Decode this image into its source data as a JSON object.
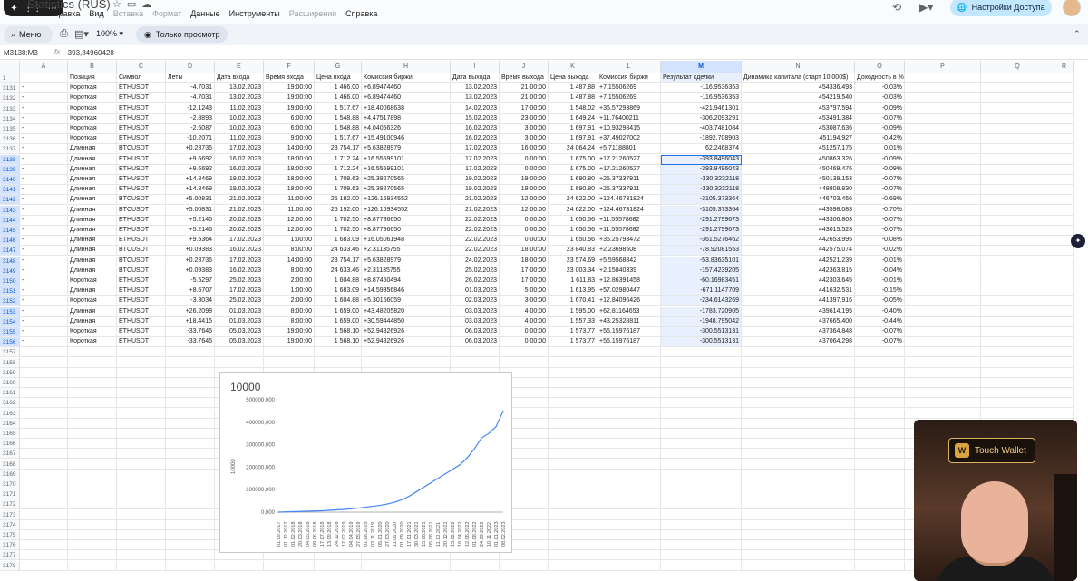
{
  "app": {
    "doc_title": "Statistics (RUS)",
    "menu": [
      "Правка",
      "Вид",
      "Вставка",
      "Формат",
      "Данные",
      "Инструменты",
      "Расширения",
      "Справка"
    ],
    "menu_dim": [
      false,
      false,
      true,
      true,
      false,
      false,
      true,
      false
    ],
    "share_label": "Настройки Доступа"
  },
  "toolbar": {
    "menu_label": "Меню",
    "zoom": "100%",
    "view_only": "Только просмотр"
  },
  "formula": {
    "namebox": "M3138:M3",
    "value": "-393,84960428"
  },
  "columns": [
    "A",
    "B",
    "C",
    "D",
    "E",
    "F",
    "G",
    "H",
    "I",
    "J",
    "K",
    "L",
    "M",
    "N",
    "O",
    "P",
    "Q",
    "R"
  ],
  "header_row": {
    "num": "1",
    "cells": [
      "",
      "Позиция",
      "Символ",
      "Леты",
      "Дата входа",
      "Время входа",
      "Цена входа",
      "Комиссия биржи",
      "Дата выхода",
      "Время выхода",
      "Цена выхода",
      "Комиссия биржи",
      "Результат сделки",
      "Динамика капитала (старт 10 000$)",
      "Доходность в %",
      "",
      "",
      ""
    ]
  },
  "rows": [
    {
      "n": "3131",
      "c": [
        "-",
        "Короткая",
        "ETHUSDT",
        "-4.7031",
        "13.02.2023",
        "19:00:00",
        "1 466.00",
        "+6.89474460",
        "13.02.2023",
        "21:00:00",
        "1 487.88",
        "+7.15506269",
        "-116.9536353",
        "454336.493",
        "-0.03%"
      ]
    },
    {
      "n": "3132",
      "c": [
        "-",
        "Короткая",
        "ETHUSDT",
        "-4.7031",
        "13.02.2023",
        "19:00:00",
        "1 466.00",
        "+6.89474460",
        "13.02.2023",
        "21:00:00",
        "1 487.88",
        "+7.15506269",
        "-116.9536353",
        "454219.540",
        "-0.03%"
      ]
    },
    {
      "n": "3133",
      "c": [
        "-",
        "Короткая",
        "ETHUSDT",
        "-12.1243",
        "11.02.2023",
        "19:00:00",
        "1 517.67",
        "+18.40068638",
        "14.02.2023",
        "17:00:00",
        "1 548.02",
        "+35.57293869",
        "-421.9461301",
        "453797.594",
        "-0.09%"
      ]
    },
    {
      "n": "3134",
      "c": [
        "-",
        "Короткая",
        "ETHUSDT",
        "-2.8893",
        "10.02.2023",
        "6:00:00",
        "1 548.88",
        "+4.47517898",
        "15.02.2023",
        "23:00:00",
        "1 649.24",
        "+11.76400211",
        "-306.2093291",
        "453491.384",
        "-0.07%"
      ]
    },
    {
      "n": "3135",
      "c": [
        "-",
        "Короткая",
        "ETHUSDT",
        "-2.6087",
        "10.02.2023",
        "6:00:00",
        "1 548.88",
        "+4.04056326",
        "16.02.2023",
        "3:00:00",
        "1 697.91",
        "+10.93298415",
        "-403.7481084",
        "453087.636",
        "-0.09%"
      ]
    },
    {
      "n": "3136",
      "c": [
        "-",
        "Короткая",
        "ETHUSDT",
        "-10.2071",
        "11.02.2023",
        "9:00:00",
        "1 517.67",
        "+15.49100946",
        "16.02.2023",
        "3:00:00",
        "1 697.91",
        "+37.49027002",
        "-1892.708903",
        "451194.927",
        "-0.42%"
      ]
    },
    {
      "n": "3137",
      "c": [
        "-",
        "Длинная",
        "BTCUSDT",
        "+0.23736",
        "17.02.2023",
        "14:00:00",
        "23 754.17",
        "+5.63828979",
        "17.02.2023",
        "16:00:00",
        "24 064.24",
        "+5.71188801",
        "62.2468374",
        "451257.175",
        "0.01%"
      ]
    },
    {
      "n": "3138",
      "c": [
        "-",
        "Длинная",
        "ETHUSDT",
        "+9.6692",
        "16.02.2023",
        "18:00:00",
        "1 712.24",
        "+16.55599101",
        "17.02.2023",
        "0:00:00",
        "1 675.00",
        "+17.21260527",
        "-393.8496043",
        "450863.326",
        "-0.09%"
      ]
    },
    {
      "n": "3139",
      "c": [
        "-",
        "Длинная",
        "ETHUSDT",
        "+9.6692",
        "16.02.2023",
        "18:00:00",
        "1 712.24",
        "+16.55599101",
        "17.02.2023",
        "0:00:00",
        "1 675.00",
        "+17.21260527",
        "-393.8496043",
        "450469.476",
        "-0.09%"
      ]
    },
    {
      "n": "3140",
      "c": [
        "-",
        "Длинная",
        "ETHUSDT",
        "+14.8469",
        "19.02.2023",
        "18:00:00",
        "1 709.63",
        "+25.38270565",
        "19.02.2023",
        "19:00:00",
        "1 690.80",
        "+25.37337911",
        "-330.3232118",
        "450139.153",
        "-0.07%"
      ]
    },
    {
      "n": "3141",
      "c": [
        "-",
        "Длинная",
        "ETHUSDT",
        "+14.8469",
        "19.02.2023",
        "18:00:00",
        "1 709.63",
        "+25.38270565",
        "19.02.2023",
        "19:00:00",
        "1 690.80",
        "+25.37337911",
        "-330.3232118",
        "449808.830",
        "-0.07%"
      ]
    },
    {
      "n": "3142",
      "c": [
        "-",
        "Длинная",
        "BTCUSDT",
        "+5.00831",
        "21.02.2023",
        "11:00:00",
        "25 192.00",
        "+126.16934552",
        "21.02.2023",
        "12:00:00",
        "24 622.00",
        "+124.46731824",
        "-3105.373364",
        "446703.456",
        "-0.69%"
      ]
    },
    {
      "n": "3143",
      "c": [
        "-",
        "Длинная",
        "BTCUSDT",
        "+5.00831",
        "21.02.2023",
        "11:00:00",
        "25 192.00",
        "+126.16934552",
        "21.02.2023",
        "12:00:00",
        "24 622.00",
        "+124.46731824",
        "-3105.373364",
        "443598.083",
        "-0.70%"
      ]
    },
    {
      "n": "3144",
      "c": [
        "-",
        "Длинная",
        "ETHUSDT",
        "+5.2146",
        "20.02.2023",
        "12:00:00",
        "1 702.50",
        "+8.87786650",
        "22.02.2023",
        "0:00:00",
        "1 650.56",
        "+11.55578682",
        "-291.2799673",
        "443306.803",
        "-0.07%"
      ]
    },
    {
      "n": "3145",
      "c": [
        "-",
        "Длинная",
        "ETHUSDT",
        "+5.2146",
        "20.02.2023",
        "12:00:00",
        "1 702.50",
        "+8.87786650",
        "22.02.2023",
        "0:00:00",
        "1 650.56",
        "+11.55578682",
        "-291.2799673",
        "443015.523",
        "-0.07%"
      ]
    },
    {
      "n": "3146",
      "c": [
        "-",
        "Длинная",
        "ETHUSDT",
        "+9.5364",
        "17.02.2023",
        "1:00:00",
        "1 683.09",
        "+16.05061948",
        "22.02.2023",
        "0:00:00",
        "1 650.56",
        "+35.25793472",
        "-361.5276462",
        "442653.995",
        "-0.08%"
      ]
    },
    {
      "n": "3147",
      "c": [
        "-",
        "Длинная",
        "BTCUSDT",
        "+0.09383",
        "16.02.2023",
        "8:00:00",
        "24 633.46",
        "+2.31135755",
        "22.02.2023",
        "18:00:00",
        "23 840.83",
        "+2.23698508",
        "-78.92081553",
        "442575.074",
        "-0.02%"
      ]
    },
    {
      "n": "3148",
      "c": [
        "-",
        "Длинная",
        "BTCUSDT",
        "+0.23736",
        "17.02.2023",
        "14:00:00",
        "23 754.17",
        "+5.63828979",
        "24.02.2023",
        "18:00:00",
        "23 574.69",
        "+5.59568842",
        "-53.83635101",
        "442521.239",
        "-0.01%"
      ]
    },
    {
      "n": "3149",
      "c": [
        "-",
        "Длинная",
        "BTCUSDT",
        "+0.09383",
        "16.02.2023",
        "8:00:00",
        "24 633.46",
        "+2.31135755",
        "25.02.2023",
        "17:00:00",
        "23 003.34",
        "+2.15840339",
        "-157.4239205",
        "442363.815",
        "-0.04%"
      ]
    },
    {
      "n": "3150",
      "c": [
        "-",
        "Короткая",
        "ETHUSDT",
        "-5.5297",
        "25.02.2023",
        "2:00:00",
        "1 604.88",
        "+8.87450494",
        "26.02.2023",
        "17:00:00",
        "1 611.83",
        "+12.86391458",
        "-60.16983451",
        "442303.645",
        "-0.01%"
      ]
    },
    {
      "n": "3151",
      "c": [
        "-",
        "Длинная",
        "ETHUSDT",
        "+8.6707",
        "17.02.2023",
        "1:00:00",
        "1 683.09",
        "+14.59356846",
        "01.03.2023",
        "5:00:00",
        "1 613.95",
        "+57.02980447",
        "-671.1147709",
        "441632.531",
        "-0.15%"
      ]
    },
    {
      "n": "3152",
      "c": [
        "-",
        "Короткая",
        "ETHUSDT",
        "-3.3034",
        "25.02.2023",
        "2:00:00",
        "1 604.88",
        "+5.30156059",
        "02.03.2023",
        "3:00:00",
        "1 670.41",
        "+12.84096426",
        "-234.6143269",
        "441397.916",
        "-0.05%"
      ]
    },
    {
      "n": "3153",
      "c": [
        "-",
        "Длинная",
        "ETHUSDT",
        "+26.2098",
        "01.03.2023",
        "8:00:00",
        "1 659.00",
        "+43.48205820",
        "03.03.2023",
        "4:00:00",
        "1 595.00",
        "+62.81164653",
        "-1783.720905",
        "439614.195",
        "-0.40%"
      ]
    },
    {
      "n": "3154",
      "c": [
        "-",
        "Длинная",
        "ETHUSDT",
        "+18.4415",
        "01.03.2023",
        "8:00:00",
        "1 659.00",
        "+30.59444850",
        "03.03.2023",
        "4:00:00",
        "1 557.33",
        "+43.25328811",
        "-1948.795042",
        "437665.400",
        "-0.44%"
      ]
    },
    {
      "n": "3155",
      "c": [
        "-",
        "Короткая",
        "ETHUSDT",
        "-33.7646",
        "05.03.2023",
        "19:00:00",
        "1 568.10",
        "+52.94826926",
        "06.03.2023",
        "0:00:00",
        "1 573.77",
        "+56.15976187",
        "-300.5513131",
        "437364.848",
        "-0.07%"
      ]
    },
    {
      "n": "3156",
      "c": [
        "-",
        "Короткая",
        "ETHUSDT",
        "-33.7646",
        "05.03.2023",
        "19:00:00",
        "1 568.10",
        "+52.94826926",
        "06.03.2023",
        "0:00:00",
        "1 573.77",
        "+56.15976187",
        "-300.5513131",
        "437064.298",
        "-0.07%"
      ]
    }
  ],
  "empty_rows": [
    "3157",
    "3158",
    "3159",
    "3160",
    "3161",
    "3162",
    "3163",
    "3164",
    "3165",
    "3166",
    "3167",
    "3168",
    "3169",
    "3170",
    "3171",
    "3172",
    "3173",
    "3174",
    "3175",
    "3176",
    "3177",
    "3178"
  ],
  "chart_data": {
    "type": "line",
    "title": "10000",
    "ylabel": "10000",
    "xlabel": "",
    "ylim": [
      0,
      500000000
    ],
    "yticks": [
      "500000,000",
      "400000,000",
      "300000,000",
      "200000,000",
      "100000,000",
      "0,000"
    ],
    "x_tick_labels": [
      "01.09.2017",
      "01.12.2017",
      "01.02.2018",
      "20.03.2018",
      "04.05.2018",
      "09.06.2018",
      "17.07.2018",
      "13.09.2018",
      "24.12.2018",
      "17.02.2019",
      "04.04.2019",
      "27.05.2019",
      "01.08.2019",
      "03.11.2019",
      "05.01.2020",
      "27.03.2020",
      "11.05.2020",
      "01.09.2020",
      "17.01.2021",
      "30.03.2021",
      "15.06.2021",
      "05.08.2021",
      "11.10.2021",
      "20.12.2021",
      "13.02.2022",
      "18.04.2022",
      "12.06.2022",
      "01.08.2022",
      "24.09.2022",
      "10.11.2022",
      "01.01.2023",
      "08.02.2023"
    ],
    "series": [
      {
        "color": "#4285f4",
        "values": [
          0,
          1000000,
          2000000,
          3000000,
          4000000,
          5000000,
          6000000,
          8000000,
          10000000,
          12000000,
          15000000,
          18000000,
          22000000,
          26000000,
          30000000,
          36000000,
          44000000,
          55000000,
          70000000,
          90000000,
          110000000,
          130000000,
          150000000,
          170000000,
          190000000,
          210000000,
          240000000,
          280000000,
          330000000,
          350000000,
          380000000,
          450000000
        ]
      }
    ],
    "grid": false,
    "legend": "none"
  },
  "webcam": {
    "logo_text": "Touch Wallet"
  }
}
